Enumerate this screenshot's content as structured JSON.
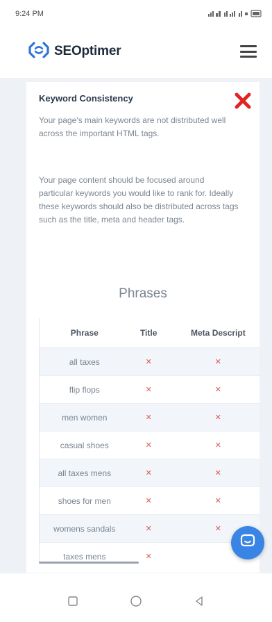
{
  "status_bar": {
    "time": "9:24 PM",
    "indicators": "⁂ ⁑ ⁂ ▾ ⌁ ▭"
  },
  "header": {
    "brand": "SEOptimer",
    "brand_color": "#1e2a3a",
    "logo_color": "#2f74d8",
    "menu_icon": "hamburger-icon"
  },
  "card": {
    "title": "Keyword Consistency",
    "status_icon": "fail-x-icon",
    "status_color": "#e02424",
    "paragraph_1": "Your page's main keywords are not distributed well across the important HTML tags.",
    "paragraph_2": "Your page content should be focused around particular keywords you would like to rank for. Ideally these keywords should also be distributed across tags such as the title, meta and header tags."
  },
  "phrases": {
    "heading": "Phrases",
    "columns": [
      "Phrase",
      "Title",
      "Meta Descript"
    ],
    "rows": [
      {
        "phrase": "all taxes",
        "title": "✕",
        "meta": "✕"
      },
      {
        "phrase": "flip flops",
        "title": "✕",
        "meta": "✕"
      },
      {
        "phrase": "men women",
        "title": "✕",
        "meta": "✕"
      },
      {
        "phrase": "casual shoes",
        "title": "✕",
        "meta": "✕"
      },
      {
        "phrase": "all taxes mens",
        "title": "✕",
        "meta": "✕"
      },
      {
        "phrase": "shoes for men",
        "title": "✕",
        "meta": "✕"
      },
      {
        "phrase": "womens sandals",
        "title": "✕",
        "meta": "✕"
      },
      {
        "phrase": "taxes mens",
        "title": "✕",
        "meta": ""
      }
    ],
    "x_color": "#e05a5a"
  },
  "chat": {
    "icon": "chat-bubble-icon",
    "color": "#3a84e6"
  },
  "nav_bar": {
    "recents_icon": "square-icon",
    "home_icon": "circle-icon",
    "back_icon": "triangle-back-icon"
  }
}
